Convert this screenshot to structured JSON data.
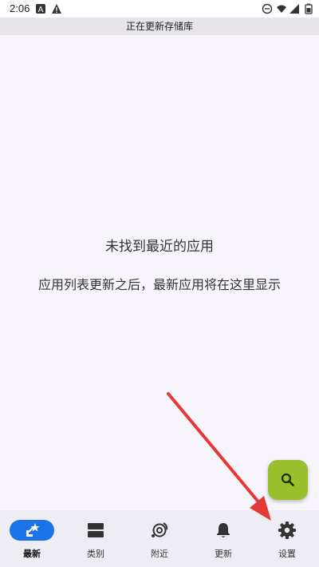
{
  "status_bar": {
    "time": "2:06",
    "icons": [
      "a-app-icon",
      "warning-icon",
      "dnd-icon",
      "wifi-icon",
      "signal-icon",
      "battery-icon"
    ]
  },
  "banner": {
    "text": "正在更新存储库"
  },
  "empty_state": {
    "title": "未找到最近的应用",
    "description": "应用列表更新之后，最新应用将在这里显示"
  },
  "fab": {
    "icon": "search-icon",
    "color": "#9bbf2c"
  },
  "bottom_nav": {
    "items": [
      {
        "label": "最新",
        "icon": "latest-star-icon",
        "active": true
      },
      {
        "label": "类别",
        "icon": "categories-icon",
        "active": false
      },
      {
        "label": "附近",
        "icon": "nearby-icon",
        "active": false
      },
      {
        "label": "更新",
        "icon": "bell-icon",
        "active": false
      },
      {
        "label": "设置",
        "icon": "gear-icon",
        "active": false
      }
    ]
  },
  "annotation": {
    "arrow_color": "#e53935",
    "arrow_icon": "red-arrow-pointing-to-settings"
  },
  "colors": {
    "accent": "#1a73e8",
    "background": "#f7f5fb",
    "nav_background": "#eeedf3"
  }
}
